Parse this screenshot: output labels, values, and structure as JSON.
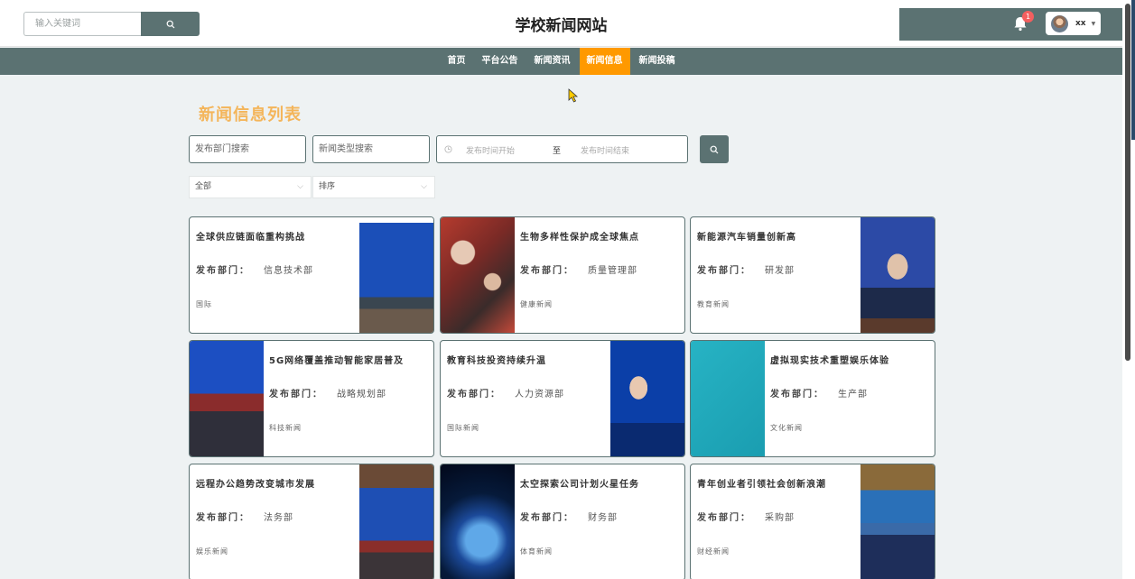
{
  "header": {
    "search_placeholder": "输入关键词",
    "site_title": "学校新闻网站",
    "notification_count": "1",
    "user_name": "xx"
  },
  "nav": {
    "items": [
      {
        "label": "首页",
        "active": false
      },
      {
        "label": "平台公告",
        "active": false
      },
      {
        "label": "新闻资讯",
        "active": false
      },
      {
        "label": "新闻信息",
        "active": true
      },
      {
        "label": "新闻投稿",
        "active": false
      }
    ]
  },
  "list": {
    "title": "新闻信息列表",
    "filters": {
      "department_placeholder": "发布部门搜索",
      "type_placeholder": "新闻类型搜索",
      "date_start_placeholder": "发布时间开始",
      "date_separator": "至",
      "date_end_placeholder": "发布时间结束",
      "select_all": "全部",
      "select_sort": "排序"
    },
    "dept_label": "发布部门：",
    "cards": [
      {
        "title": "全球供应链面临重构挑战",
        "dept": "信息技术部",
        "type": "国际"
      },
      {
        "title": "生物多样性保护成全球焦点",
        "dept": "质量管理部",
        "type": "健康新闻"
      },
      {
        "title": "新能源汽车销量创新高",
        "dept": "研发部",
        "type": "教育新闻"
      },
      {
        "title": "5G网络覆盖推动智能家居普及",
        "dept": "战略规划部",
        "type": "科技新闻"
      },
      {
        "title": "教育科技投资持续升温",
        "dept": "人力资源部",
        "type": "国际新闻"
      },
      {
        "title": "虚拟现实技术重塑娱乐体验",
        "dept": "生产部",
        "type": "文化新闻"
      },
      {
        "title": "远程办公趋势改变城市发展",
        "dept": "法务部",
        "type": "娱乐新闻"
      },
      {
        "title": "太空探索公司计划火星任务",
        "dept": "财务部",
        "type": "体育新闻"
      },
      {
        "title": "青年创业者引领社会创新浪潮",
        "dept": "采购部",
        "type": "财经新闻"
      }
    ]
  },
  "colors": {
    "primary": "#5b7272",
    "accent": "#ff9900",
    "title_orange": "#f4b55a",
    "badge_red": "#f35f5f"
  }
}
